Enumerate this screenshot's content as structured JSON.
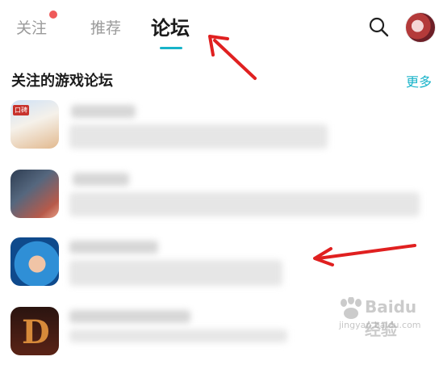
{
  "tabs": [
    {
      "label": "关注",
      "has_dot": true
    },
    {
      "label": "推荐"
    },
    {
      "label": "论坛",
      "active": true
    }
  ],
  "icons": {
    "search": "search-icon",
    "avatar": "user-avatar"
  },
  "section": {
    "title": "关注的游戏论坛",
    "more": "更多"
  },
  "game_items": [
    {
      "icon": "anime-girl-game-icon",
      "badge": "口碑"
    },
    {
      "icon": "dark-hero-game-icon"
    },
    {
      "icon": "jinx-character-game-icon"
    },
    {
      "icon": "dark-fantasy-game-icon",
      "letter": "D"
    }
  ],
  "watermark": {
    "brand": "Baidu经验",
    "url": "jingyan.baidu.com"
  },
  "colors": {
    "accent": "#18b3c9",
    "dot": "#ef5a5a",
    "arrow": "#e02020"
  }
}
